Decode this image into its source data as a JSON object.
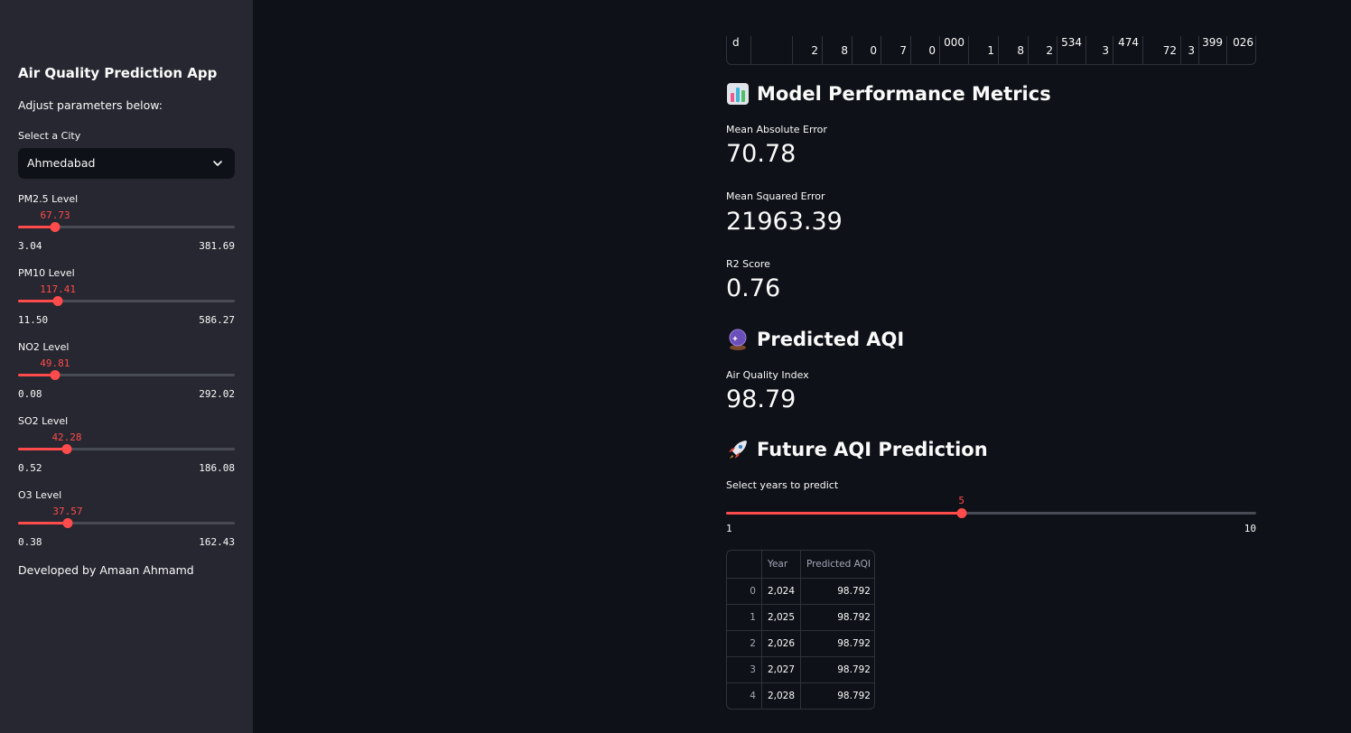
{
  "sidebar": {
    "title": "Air Quality Prediction App",
    "subtitle": "Adjust parameters below:",
    "city_label": "Select a City",
    "city_value": "Ahmedabad",
    "sliders": [
      {
        "label": "PM2.5 Level",
        "value": "67.73",
        "min": "3.04",
        "max": "381.69",
        "fraction": 0.171
      },
      {
        "label": "PM10 Level",
        "value": "117.41",
        "min": "11.50",
        "max": "586.27",
        "fraction": 0.184
      },
      {
        "label": "NO2 Level",
        "value": "49.81",
        "min": "0.08",
        "max": "292.02",
        "fraction": 0.17
      },
      {
        "label": "SO2 Level",
        "value": "42.28",
        "min": "0.52",
        "max": "186.08",
        "fraction": 0.225
      },
      {
        "label": "O3 Level",
        "value": "37.57",
        "min": "0.38",
        "max": "162.43",
        "fraction": 0.229
      }
    ],
    "footer": "Developed by Amaan Ahmamd"
  },
  "top_table": {
    "row_label": "d",
    "cells": [
      "",
      "2",
      "8",
      "0",
      "7",
      "0",
      "000",
      "1",
      "8",
      "2",
      "534",
      "3",
      "474",
      "72",
      "3",
      "399",
      "026"
    ]
  },
  "metrics": {
    "heading": "Model Performance Metrics",
    "items": [
      {
        "label": "Mean Absolute Error",
        "value": "70.78"
      },
      {
        "label": "Mean Squared Error",
        "value": "21963.39"
      },
      {
        "label": "R2 Score",
        "value": "0.76"
      }
    ]
  },
  "predicted": {
    "heading": "Predicted AQI",
    "label": "Air Quality Index",
    "value": "98.79"
  },
  "future": {
    "heading": "Future AQI Prediction",
    "slider_label": "Select years to predict",
    "value": "5",
    "min": "1",
    "max": "10",
    "fraction": 0.444,
    "table": {
      "columns": [
        "",
        "Year",
        "Predicted AQI"
      ],
      "rows": [
        [
          "0",
          "2,024",
          "98.792"
        ],
        [
          "1",
          "2,025",
          "98.792"
        ],
        [
          "2",
          "2,026",
          "98.792"
        ],
        [
          "3",
          "2,027",
          "98.792"
        ],
        [
          "4",
          "2,028",
          "98.792"
        ]
      ]
    }
  },
  "icons": {
    "chart": "bar-chart-icon",
    "crystal": "crystal-ball-icon",
    "rocket": "rocket-icon",
    "chevron": "chevron-down-icon"
  },
  "colors": {
    "accent": "#ff4b4b",
    "background": "#0e1117",
    "sidebar": "#262730"
  }
}
